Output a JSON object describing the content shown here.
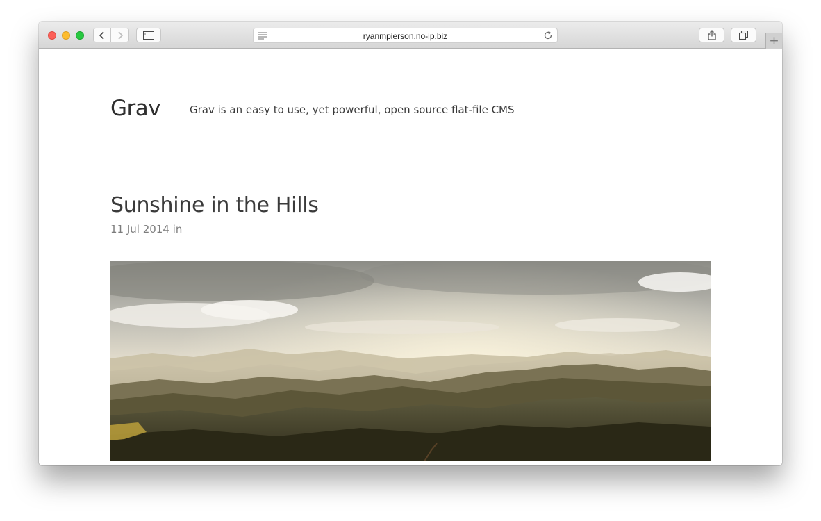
{
  "browser": {
    "url": "ryanmpierson.no-ip.biz",
    "icons": [
      "back-icon",
      "forward-icon",
      "sidebar-icon",
      "reader-icon",
      "reload-icon",
      "share-icon",
      "tabs-icon",
      "plus-icon"
    ],
    "new_tab_label": "+"
  },
  "site": {
    "title": "Grav",
    "tagline": "Grav is an easy to use, yet powerful, open source flat-file CMS"
  },
  "post": {
    "title": "Sunshine in the Hills",
    "meta": "11 Jul 2014 in",
    "image_alt": "landscape photo of hazy hills under a cloudy sky"
  }
}
